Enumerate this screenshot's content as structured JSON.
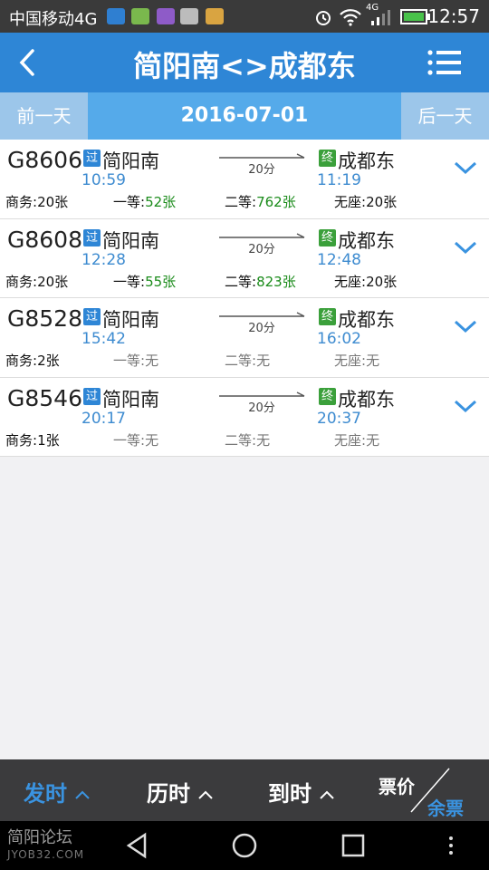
{
  "status": {
    "carrier": "中国移动4G",
    "net": "4G",
    "time": "12:57"
  },
  "header": {
    "title": "简阳南<>成都东"
  },
  "datebar": {
    "prev": "前一天",
    "date": "2016-07-01",
    "next": "后一天"
  },
  "trains": [
    {
      "no": "G8606",
      "pass_badge": "过",
      "from": "简阳南",
      "dep": "10:59",
      "duration": "20分",
      "end_badge": "终",
      "to": "成都东",
      "arr": "11:19",
      "seats": {
        "biz_label": "商务:",
        "biz": "20张",
        "first_label": "一等:",
        "first": "52张",
        "second_label": "二等:",
        "second": "762张",
        "none_label": "无座:",
        "none": "20张"
      }
    },
    {
      "no": "G8608",
      "pass_badge": "过",
      "from": "简阳南",
      "dep": "12:28",
      "duration": "20分",
      "end_badge": "终",
      "to": "成都东",
      "arr": "12:48",
      "seats": {
        "biz_label": "商务:",
        "biz": "20张",
        "first_label": "一等:",
        "first": "55张",
        "second_label": "二等:",
        "second": "823张",
        "none_label": "无座:",
        "none": "20张"
      }
    },
    {
      "no": "G8528",
      "pass_badge": "过",
      "from": "简阳南",
      "dep": "15:42",
      "duration": "20分",
      "end_badge": "终",
      "to": "成都东",
      "arr": "16:02",
      "seats": {
        "biz_label": "商务:",
        "biz": "2张",
        "first_label": "一等:",
        "first": "无",
        "second_label": "二等:",
        "second": "无",
        "none_label": "无座:",
        "none": "无"
      }
    },
    {
      "no": "G8546",
      "pass_badge": "过",
      "from": "简阳南",
      "dep": "20:17",
      "duration": "20分",
      "end_badge": "终",
      "to": "成都东",
      "arr": "20:37",
      "seats": {
        "biz_label": "商务:",
        "biz": "1张",
        "first_label": "一等:",
        "first": "无",
        "second_label": "二等:",
        "second": "无",
        "none_label": "无座:",
        "none": "无"
      }
    }
  ],
  "sortbar": {
    "depart": "发时",
    "duration": "历时",
    "arrive": "到时",
    "price": "票价",
    "remain": "余票"
  },
  "watermark": {
    "line1": "简阳论坛",
    "line2": "JYOB32.COM"
  },
  "colors": {
    "primary": "#2e86d6",
    "datebar": "#55aaea",
    "seat_available": "#1a8b1a",
    "time": "#3d8bd0"
  }
}
